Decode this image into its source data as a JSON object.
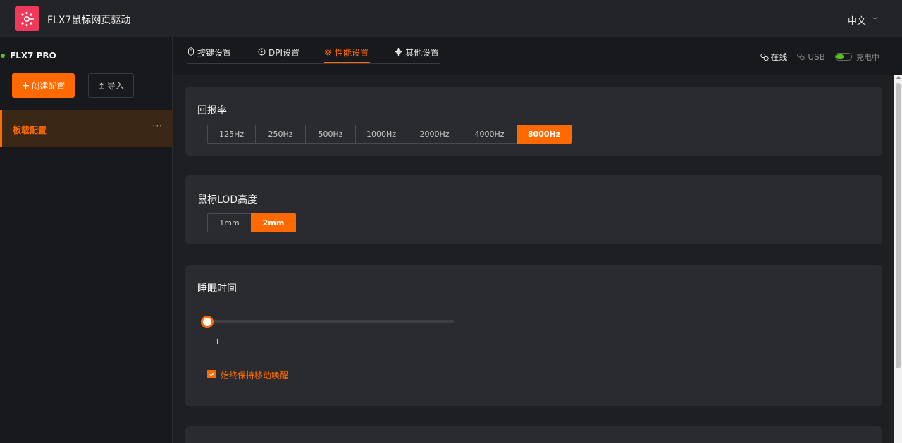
{
  "app": {
    "title": "FLX7鼠标网页驱动",
    "language": "中文"
  },
  "sidebar": {
    "device_name": "FLX7 PRO",
    "create_label": "创建配置",
    "import_label": "导入",
    "configs": [
      {
        "label": "板载配置",
        "more": "···"
      }
    ]
  },
  "tabs": [
    {
      "label": "按键设置",
      "icon": "mouse-icon"
    },
    {
      "label": "DPI设置",
      "icon": "target-icon"
    },
    {
      "label": "性能设置",
      "icon": "gear-icon",
      "active": true
    },
    {
      "label": "其他设置",
      "icon": "cog-icon"
    }
  ],
  "status": {
    "online": "在线",
    "connection": "USB",
    "charging": "充电中",
    "battery_level": 0.45
  },
  "polling": {
    "title": "回报率",
    "options": [
      "125Hz",
      "250Hz",
      "500Hz",
      "1000Hz",
      "2000Hz",
      "4000Hz",
      "8000Hz"
    ],
    "selected": "8000Hz"
  },
  "lod": {
    "title": "鼠标LOD高度",
    "options": [
      "1mm",
      "2mm"
    ],
    "selected": "2mm"
  },
  "sleep": {
    "title": "睡眠时间",
    "value": "1",
    "keep_awake_label": "始终保持移动唤醒",
    "keep_awake_checked": true
  },
  "colors": {
    "accent": "#ff6a00",
    "logo": "#f0385a",
    "online_dot": "#52c41a"
  }
}
